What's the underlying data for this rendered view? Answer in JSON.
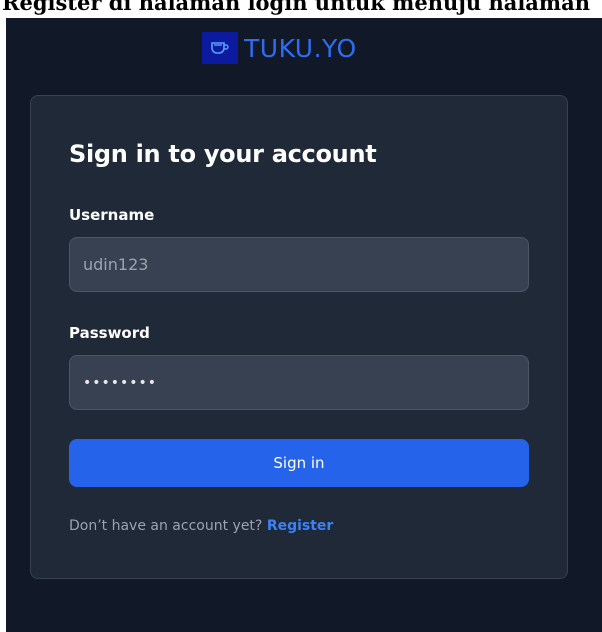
{
  "caption": {
    "text": "Register di halaman login untuk menuju halaman"
  },
  "brand": {
    "name": "TUKU.YO",
    "icon": "cup-icon",
    "color": "#2f6df0",
    "logo_bg": "#0b1a9e"
  },
  "form": {
    "title": "Sign in to your account",
    "username": {
      "label": "Username",
      "placeholder": "udin123"
    },
    "password": {
      "label": "Password",
      "value": "••••••••"
    },
    "submit_label": "Sign in",
    "footer": {
      "text": "Don’t have an account yet?",
      "link_label": "Register"
    }
  },
  "colors": {
    "page_bg": "#111827",
    "card_bg": "#1f2937",
    "input_bg": "#374151",
    "accent": "#2563eb",
    "link": "#3b82f6"
  }
}
